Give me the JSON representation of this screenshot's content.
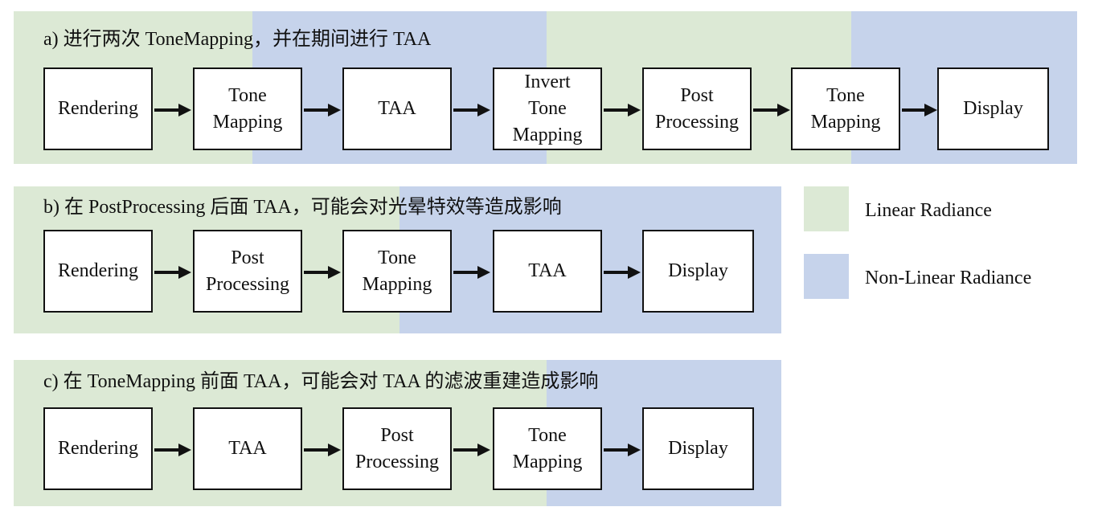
{
  "colors": {
    "linear": "#dce9d5",
    "nonlinear": "#c6d3eb"
  },
  "rows": [
    {
      "title": "a) 进行两次 ToneMapping，并在期间进行 TAA",
      "boxes": [
        "Rendering",
        "Tone\nMapping",
        "TAA",
        "Invert\nTone\nMapping",
        "Post\nProcessing",
        "Tone\nMapping",
        "Display"
      ]
    },
    {
      "title": "b) 在 PostProcessing 后面 TAA，可能会对光晕特效等造成影响",
      "boxes": [
        "Rendering",
        "Post\nProcessing",
        "Tone\nMapping",
        "TAA",
        "Display"
      ]
    },
    {
      "title": "c) 在 ToneMapping 前面 TAA，可能会对 TAA 的滤波重建造成影响",
      "boxes": [
        "Rendering",
        "TAA",
        "Post\nProcessing",
        "Tone\nMapping",
        "Display"
      ]
    }
  ],
  "legend": {
    "linear": "Linear Radiance",
    "nonlinear": "Non-Linear Radiance"
  }
}
